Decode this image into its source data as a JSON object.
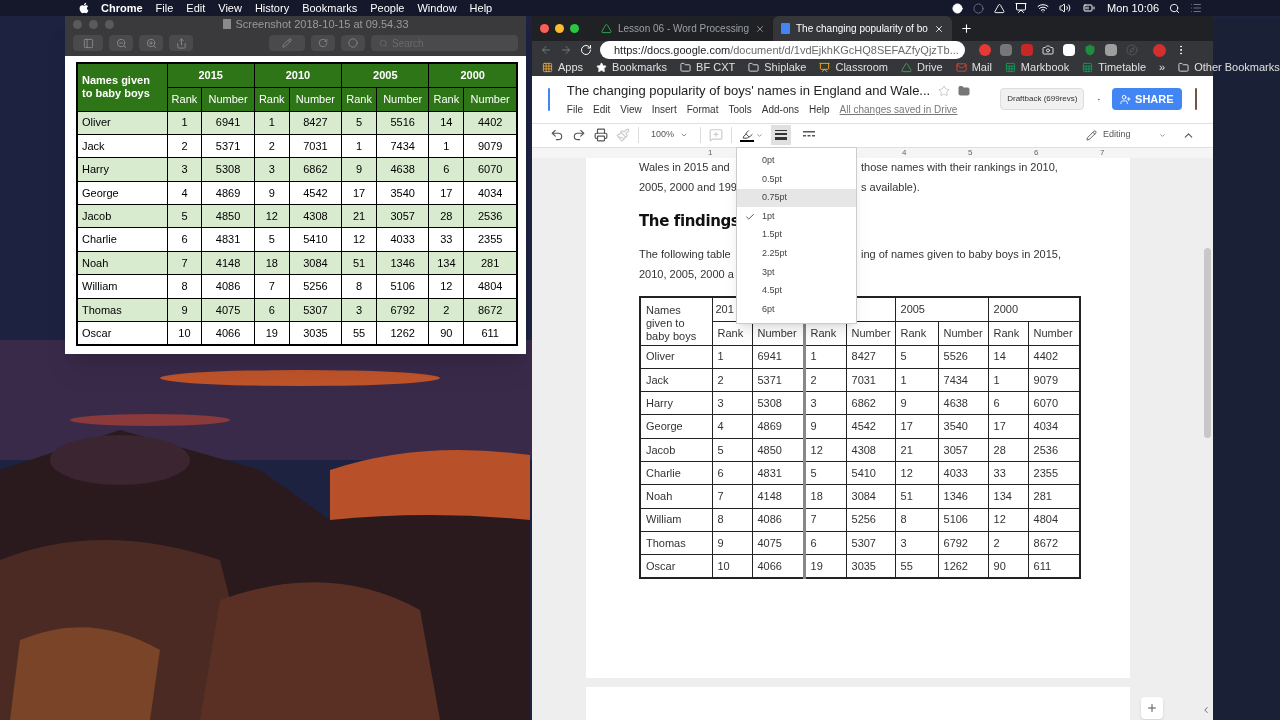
{
  "menubar": {
    "app": "Chrome",
    "menus": [
      "File",
      "Edit",
      "View",
      "History",
      "Bookmarks",
      "People",
      "Window",
      "Help"
    ],
    "clock": "Mon 10:06"
  },
  "preview": {
    "title": "Screenshot 2018-10-15 at 09.54.33",
    "search_placeholder": "Search",
    "table": {
      "corner": "Names given to baby boys",
      "years": [
        "2015",
        "2010",
        "2005",
        "2000"
      ],
      "subheaders": [
        "Rank",
        "Number",
        "Rank",
        "Number",
        "Rank",
        "Number",
        "Rank",
        "Number"
      ],
      "rows": [
        {
          "name": "Oliver",
          "cells": [
            "1",
            "6941",
            "1",
            "8427",
            "5",
            "5516",
            "14",
            "4402"
          ]
        },
        {
          "name": "Jack",
          "cells": [
            "2",
            "5371",
            "2",
            "7031",
            "1",
            "7434",
            "1",
            "9079"
          ]
        },
        {
          "name": "Harry",
          "cells": [
            "3",
            "5308",
            "3",
            "6862",
            "9",
            "4638",
            "6",
            "6070"
          ]
        },
        {
          "name": "George",
          "cells": [
            "4",
            "4869",
            "9",
            "4542",
            "17",
            "3540",
            "17",
            "4034"
          ]
        },
        {
          "name": "Jacob",
          "cells": [
            "5",
            "4850",
            "12",
            "4308",
            "21",
            "3057",
            "28",
            "2536"
          ]
        },
        {
          "name": "Charlie",
          "cells": [
            "6",
            "4831",
            "5",
            "5410",
            "12",
            "4033",
            "33",
            "2355"
          ]
        },
        {
          "name": "Noah",
          "cells": [
            "7",
            "4148",
            "18",
            "3084",
            "51",
            "1346",
            "134",
            "281"
          ]
        },
        {
          "name": "William",
          "cells": [
            "8",
            "4086",
            "7",
            "5256",
            "8",
            "5106",
            "12",
            "4804"
          ]
        },
        {
          "name": "Thomas",
          "cells": [
            "9",
            "4075",
            "6",
            "5307",
            "3",
            "6792",
            "2",
            "8672"
          ]
        },
        {
          "name": "Oscar",
          "cells": [
            "10",
            "4066",
            "19",
            "3035",
            "55",
            "1262",
            "90",
            "611"
          ]
        }
      ]
    }
  },
  "chrome": {
    "tabs": [
      {
        "title": "Lesson 06 - Word Processing",
        "kind": "drive",
        "selected": false
      },
      {
        "title": "The changing popularity of bo",
        "kind": "docs",
        "selected": true
      }
    ],
    "url_host": "https://docs.google.com",
    "url_path": "/document/d/1vdEjkhKGcHQ8SEFAZfyQjzTb...",
    "bookmarks": [
      {
        "label": "Apps",
        "kind": "apps"
      },
      {
        "label": "Bookmarks",
        "kind": "star"
      },
      {
        "label": "BF CXT",
        "kind": "folder"
      },
      {
        "label": "Shiplake",
        "kind": "folder"
      },
      {
        "label": "Classroom",
        "kind": "classroom"
      },
      {
        "label": "Drive",
        "kind": "drive"
      },
      {
        "label": "Mail",
        "kind": "mail"
      },
      {
        "label": "Markbook",
        "kind": "sheet"
      },
      {
        "label": "Timetable",
        "kind": "sheet"
      }
    ],
    "more_bookmarks": "»",
    "other_bookmarks": "Other Bookmarks"
  },
  "docs": {
    "title": "The changing popularity of boys' names in England and Wale...",
    "menus": [
      "File",
      "Edit",
      "View",
      "Insert",
      "Format",
      "Tools",
      "Add-ons",
      "Help"
    ],
    "save_status": "All changes saved in Drive",
    "draftback": "Draftback (699revs)",
    "share": "SHARE",
    "zoom": "100%",
    "mode": "Editing",
    "ruler": {
      "left_numbers": [
        "1"
      ],
      "right_numbers": [
        "4",
        "5",
        "6",
        "7"
      ]
    },
    "lines_before": [
      {
        "left": "Wales in 2015 and",
        "right": "those names with their rankings in 2010,"
      },
      {
        "left": "2005, 2000 and 199",
        "right": "s available)."
      }
    ],
    "heading": "The findings",
    "lines_after": [
      {
        "left": "The following table",
        "right": "ing of names given to baby boys in 2015,"
      },
      {
        "left": "2010, 2005, 2000 a"
      }
    ],
    "table": {
      "corner": "Names given to baby boys",
      "first_year": "201",
      "years": [
        "2005",
        "2000"
      ],
      "subheaders": [
        "Rank",
        "Number",
        "Rank",
        "Number",
        "Rank",
        "Number",
        "Rank",
        "Number"
      ],
      "rows": [
        {
          "name": "Oliver",
          "cells": [
            "1",
            "6941",
            "1",
            "8427",
            "5",
            "5526",
            "14",
            "4402"
          ]
        },
        {
          "name": "Jack",
          "cells": [
            "2",
            "5371",
            "2",
            "7031",
            "1",
            "7434",
            "1",
            "9079"
          ]
        },
        {
          "name": "Harry",
          "cells": [
            "3",
            "5308",
            "3",
            "6862",
            "9",
            "4638",
            "6",
            "6070"
          ]
        },
        {
          "name": "George",
          "cells": [
            "4",
            "4869",
            "9",
            "4542",
            "17",
            "3540",
            "17",
            "4034"
          ]
        },
        {
          "name": "Jacob",
          "cells": [
            "5",
            "4850",
            "12",
            "4308",
            "21",
            "3057",
            "28",
            "2536"
          ]
        },
        {
          "name": "Charlie",
          "cells": [
            "6",
            "4831",
            "5",
            "5410",
            "12",
            "4033",
            "33",
            "2355"
          ]
        },
        {
          "name": "Noah",
          "cells": [
            "7",
            "4148",
            "18",
            "3084",
            "51",
            "1346",
            "134",
            "281"
          ]
        },
        {
          "name": "William",
          "cells": [
            "8",
            "4086",
            "7",
            "5256",
            "8",
            "5106",
            "12",
            "4804"
          ]
        },
        {
          "name": "Thomas",
          "cells": [
            "9",
            "4075",
            "6",
            "5307",
            "3",
            "6792",
            "2",
            "8672"
          ]
        },
        {
          "name": "Oscar",
          "cells": [
            "10",
            "4066",
            "19",
            "3035",
            "55",
            "1262",
            "90",
            "611"
          ]
        }
      ]
    },
    "border_menu": [
      {
        "label": "0pt",
        "selected": false,
        "highlighted": false
      },
      {
        "label": "0.5pt",
        "selected": false,
        "highlighted": false
      },
      {
        "label": "0.75pt",
        "selected": false,
        "highlighted": true
      },
      {
        "label": "1pt",
        "selected": true,
        "highlighted": false
      },
      {
        "label": "1.5pt",
        "selected": false,
        "highlighted": false
      },
      {
        "label": "2.25pt",
        "selected": false,
        "highlighted": false
      },
      {
        "label": "3pt",
        "selected": false,
        "highlighted": false
      },
      {
        "label": "4.5pt",
        "selected": false,
        "highlighted": false
      },
      {
        "label": "6pt",
        "selected": false,
        "highlighted": false
      }
    ]
  }
}
